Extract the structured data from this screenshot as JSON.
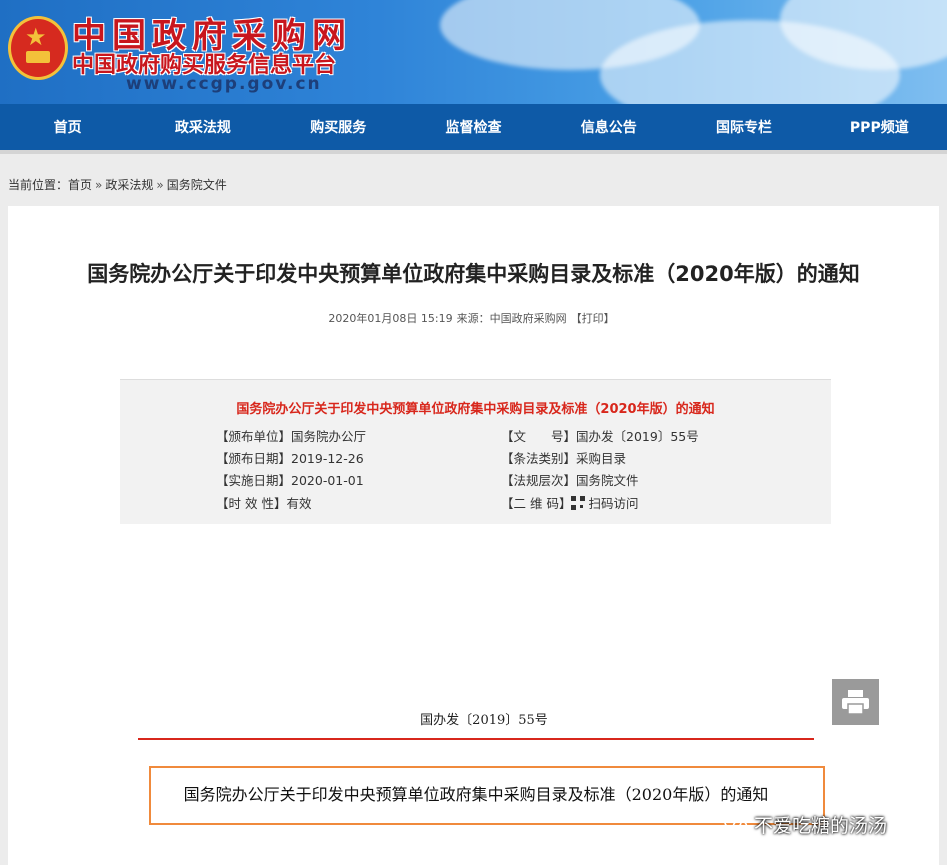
{
  "header": {
    "site_name": "中国政府采购网",
    "site_sub": "中国政府购买服务信息平台",
    "site_url": "www.ccgp.gov.cn"
  },
  "nav": {
    "items": [
      "首页",
      "政采法规",
      "购买服务",
      "监督检查",
      "信息公告",
      "国际专栏",
      "PPP频道"
    ]
  },
  "breadcrumb": {
    "prefix": "当前位置：",
    "items": [
      "首页",
      "政采法规",
      "国务院文件"
    ],
    "separator": "»"
  },
  "article": {
    "title": "国务院办公厅关于印发中央预算单位政府集中采购目录及标准（2020年版）的通知",
    "datetime": "2020年01月08日 15:19",
    "source": "来源：中国政府采购网",
    "print_label": "【打印】"
  },
  "infobox": {
    "title": "国务院办公厅关于印发中央预算单位政府集中采购目录及标准（2020年版）的通知",
    "left": [
      {
        "label": "【颁布单位】",
        "value": "国务院办公厅"
      },
      {
        "label": "【颁布日期】",
        "value": "2019-12-26"
      },
      {
        "label": "【实施日期】",
        "value": "2020-01-01"
      },
      {
        "label": "【时 效 性】",
        "value": "有效"
      }
    ],
    "right": [
      {
        "label": "【文　　号】",
        "value": "国办发〔2019〕55号"
      },
      {
        "label": "【条法类别】",
        "value": "采购目录"
      },
      {
        "label": "【法规层次】",
        "value": "国务院文件"
      },
      {
        "label": "【二 维 码】",
        "value": "扫码访问"
      }
    ]
  },
  "body": {
    "doc_number": "国办发〔2019〕55号",
    "doc_title": "国务院办公厅关于印发中央预算单位政府集中采购目录及标准（2020年版）的通知"
  },
  "watermark": {
    "text": "不爱吃糖的汤汤"
  },
  "colors": {
    "nav_bg": "#0e5aa7",
    "accent_red": "#d8271c",
    "highlight_box": "#f08a3c"
  }
}
